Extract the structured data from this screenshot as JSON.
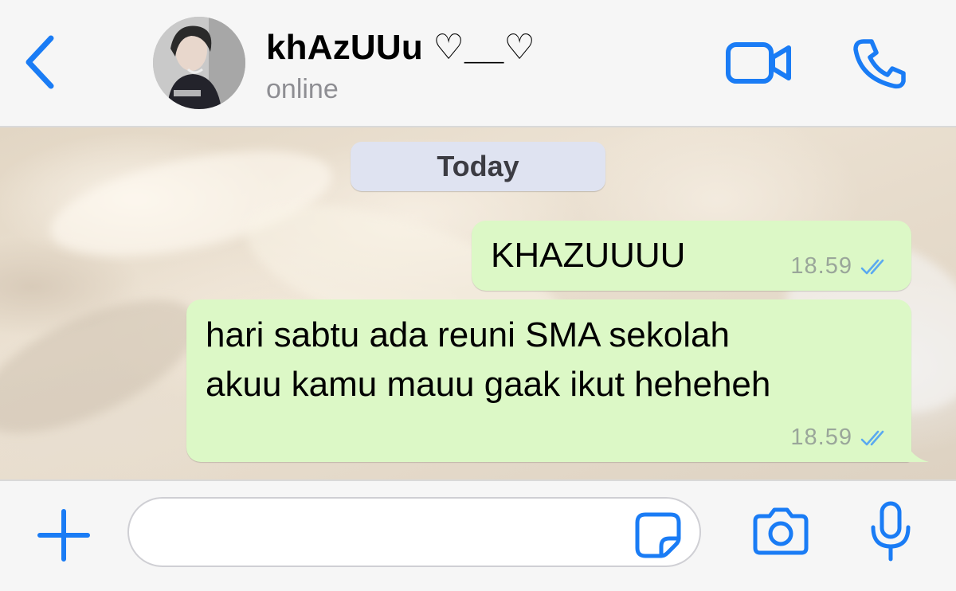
{
  "header": {
    "contact_name": "khAzUUu ♡__♡",
    "status": "online",
    "back_icon": "chevron-left-icon",
    "video_icon": "video-camera-icon",
    "call_icon": "phone-icon"
  },
  "chat": {
    "date_divider": "Today",
    "messages": [
      {
        "lines": [
          "KHAZUUUU"
        ],
        "time": "18.59",
        "status": "read",
        "direction": "outgoing"
      },
      {
        "lines": [
          "hari sabtu ada reuni SMA sekolah",
          "akuu kamu mauu gaak ikut heheheh"
        ],
        "time": "18.59",
        "status": "read",
        "direction": "outgoing"
      }
    ]
  },
  "input": {
    "value": "",
    "placeholder": "",
    "plus_icon": "plus-icon",
    "sticker_icon": "sticker-icon",
    "camera_icon": "camera-icon",
    "mic_icon": "microphone-icon"
  },
  "colors": {
    "accent": "#1a7cf5",
    "bubble_outgoing": "#dcf8c6",
    "date_pill": "#dfe3f1",
    "read_ticks": "#5aa9f0"
  }
}
